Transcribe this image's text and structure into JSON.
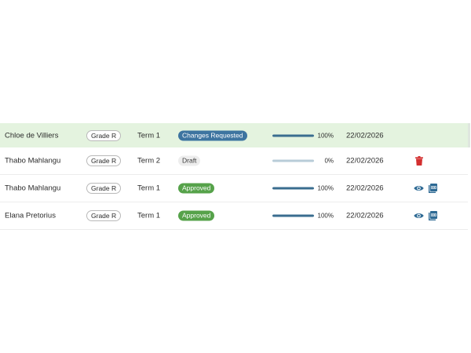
{
  "table": {
    "rows": [
      {
        "name": "Chloe de Villiers",
        "grade": "Grade R",
        "term": "Term 1",
        "status": "Changes Requested",
        "progress": 1.0,
        "progress_label": "100%",
        "date": "22/02/2026",
        "actions": []
      },
      {
        "name": "Thabo Mahlangu",
        "grade": "Grade R",
        "term": "Term 2",
        "status": "Draft",
        "progress": 0.0,
        "progress_label": "0%",
        "date": "22/02/2026",
        "actions": [
          "trash-icon"
        ]
      },
      {
        "name": "Thabo Mahlangu",
        "grade": "Grade R",
        "term": "Term 1",
        "status": "Approved",
        "progress": 1.0,
        "progress_label": "100%",
        "date": "22/02/2026",
        "actions": [
          "eye-icon",
          "pdf-icon"
        ]
      },
      {
        "name": "Elana Pretorius",
        "grade": "Grade R",
        "term": "Term 1",
        "status": "Approved",
        "progress": 1.0,
        "progress_label": "100%",
        "date": "22/02/2026",
        "actions": [
          "eye-icon",
          "pdf-icon"
        ]
      }
    ]
  },
  "colors": {
    "highlight_row": "#e4f3df",
    "status_changes_requested": "#3d74a0",
    "status_draft": "#ededed",
    "status_approved": "#56a24a",
    "progress_fill": "#3a6d8f",
    "progress_track": "#b8ccd8",
    "delete_icon": "#d32f2f",
    "view_icon": "#2e6a94"
  }
}
